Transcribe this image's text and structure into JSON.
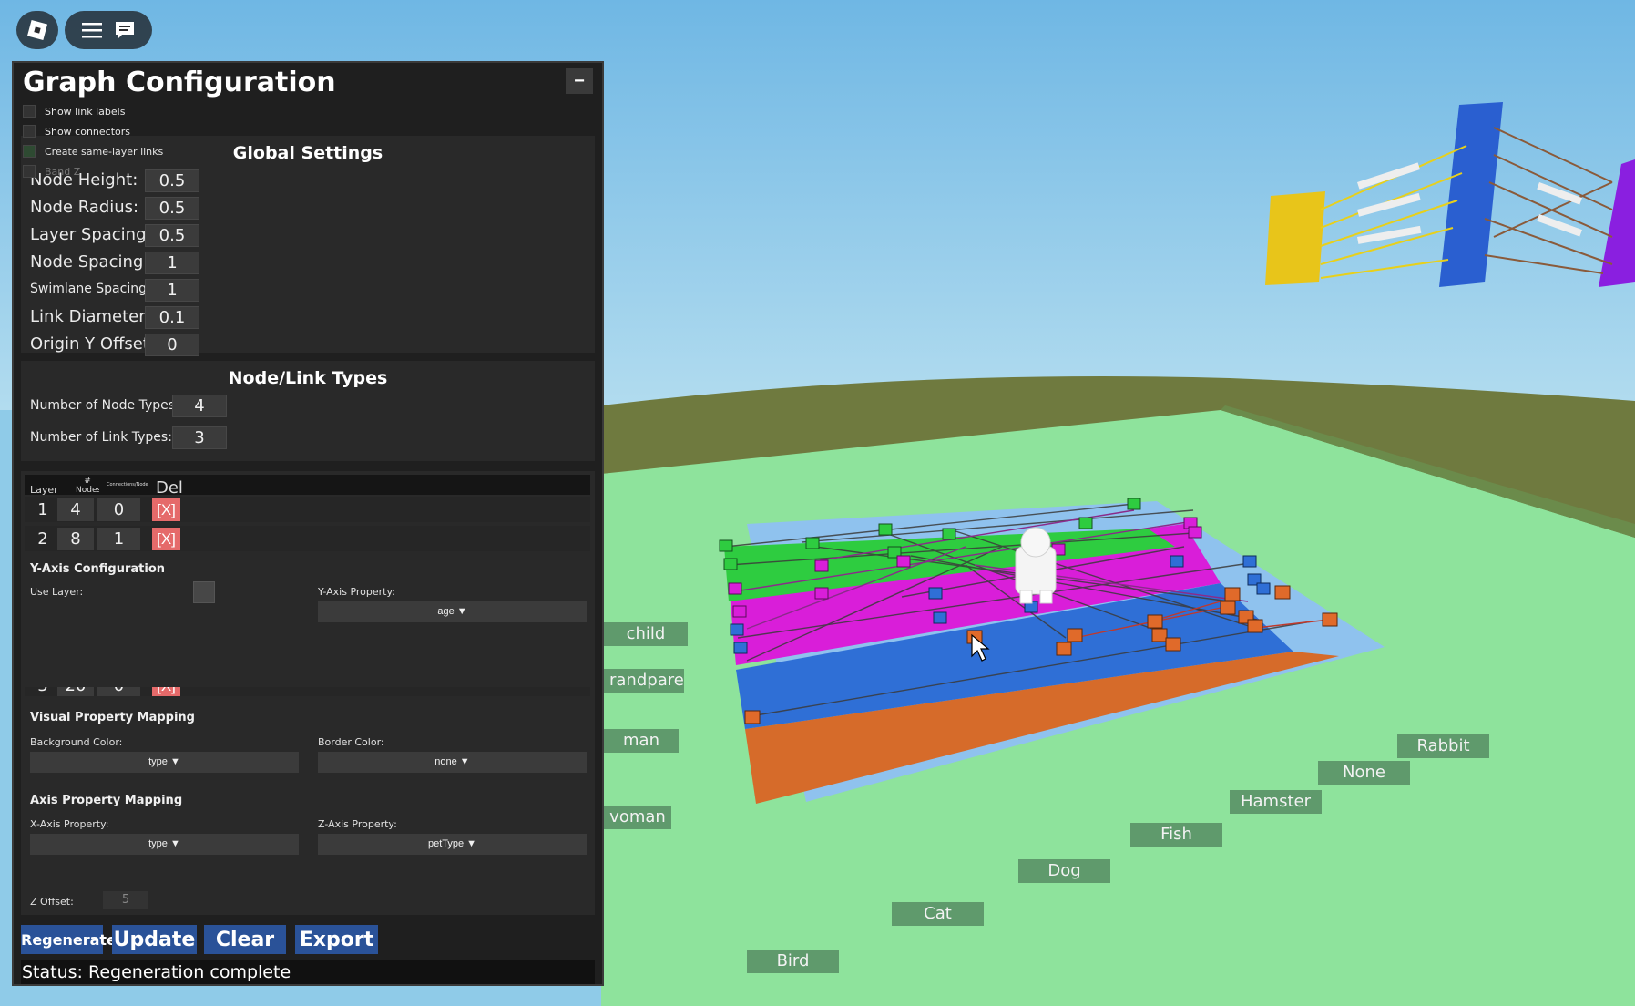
{
  "panel": {
    "title": "Graph Configuration",
    "minimize_label": "−",
    "toggles": [
      {
        "label": "Show link labels"
      },
      {
        "label": "Show connectors"
      },
      {
        "label": "Create same-layer links"
      },
      {
        "label": "Band Z"
      }
    ]
  },
  "global_settings": {
    "title": "Global Settings",
    "fields": [
      {
        "label": "Node Height:",
        "value": "0.5"
      },
      {
        "label": "Node Radius:",
        "value": "0.5"
      },
      {
        "label": "Layer Spacing:",
        "value": "0.5"
      },
      {
        "label": "Node Spacing:",
        "value": "1"
      },
      {
        "label": "Swimlane Spacing:",
        "value": "1"
      },
      {
        "label": "Link Diameter:",
        "value": "0.1"
      },
      {
        "label": "Origin Y Offset:",
        "value": "0"
      }
    ]
  },
  "node_link_types": {
    "title": "Node/Link Types",
    "node_types_label": "Number of Node Types:",
    "node_types_value": "4",
    "link_types_label": "Number of Link Types:",
    "link_types_value": "3"
  },
  "layer_table": {
    "headers": {
      "layer": "Layer",
      "nodes": "# Nodes",
      "connections": "Connections/Node",
      "del": "Del"
    },
    "rows": [
      {
        "layer": "1",
        "nodes": "4",
        "connections": "0",
        "del": "[X]"
      },
      {
        "layer": "2",
        "nodes": "8",
        "connections": "1",
        "del": "[X]"
      },
      {
        "layer": "3",
        "nodes": "20",
        "connections": "0",
        "del": "[X]"
      }
    ]
  },
  "y_axis": {
    "title": "Y-Axis Configuration",
    "use_layer_label": "Use Layer:",
    "property_label": "Y-Axis Property:",
    "property_value": "age ▼"
  },
  "visual_mapping": {
    "title": "Visual Property Mapping",
    "background_label": "Background Color:",
    "background_value": "type ▼",
    "border_label": "Border Color:",
    "border_value": "none ▼"
  },
  "axis_mapping": {
    "title": "Axis Property Mapping",
    "x_label": "X-Axis Property:",
    "x_value": "type ▼",
    "z_label": "Z-Axis Property:",
    "z_value": "petType ▼"
  },
  "z_offset": {
    "label": "Z Offset:",
    "value": "5"
  },
  "buttons": {
    "regenerate": "Regenerate",
    "update": "Update",
    "clear": "Clear",
    "export": "Export"
  },
  "status": "Status: Regeneration complete",
  "world_labels": {
    "child": "child",
    "grandparent": "randparent",
    "man": "man",
    "woman": "voman",
    "rabbit": "Rabbit",
    "none": "None",
    "hamster": "Hamster",
    "fish": "Fish",
    "dog": "Dog",
    "cat": "Cat",
    "bird": "Bird"
  },
  "colors": {
    "sky": "#8fcbe8",
    "ground": "#8ee39c",
    "panel_bg": "#1f1f1f",
    "section_bg": "#292929",
    "button_blue": "#2a5298",
    "delete_red": "#e56a6a",
    "layer_green": "#2ecc40",
    "layer_magenta": "#d91ed9",
    "layer_blue": "#2f6fd6",
    "layer_orange": "#e06a2a"
  }
}
